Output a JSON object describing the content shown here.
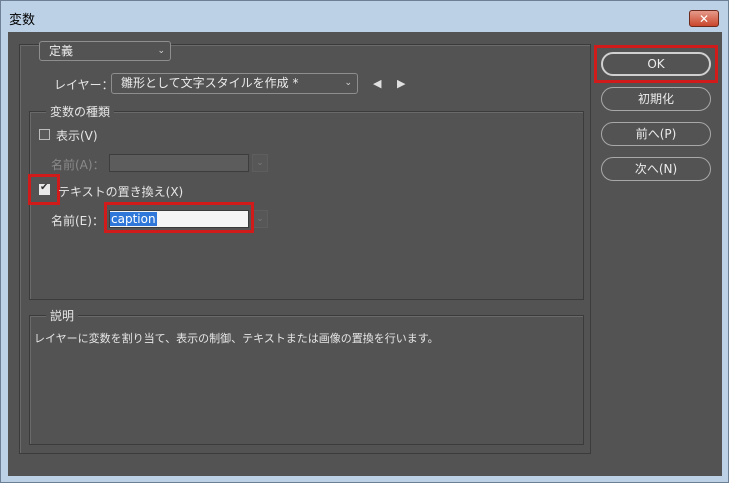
{
  "window": {
    "title": "変数",
    "close_glyph": "✕"
  },
  "definition": {
    "dropdown_value": "定義",
    "layer_label": "レイヤー：",
    "layer_value": "雛形として文字スタイルを作成 *"
  },
  "variable_types": {
    "legend": "変数の種類",
    "visibility": {
      "label": "表示(V)",
      "checked": false,
      "name_label": "名前(A)：",
      "name_value": ""
    },
    "text_replacement": {
      "label": "テキストの置き換え(X)",
      "checked": true,
      "name_label": "名前(E)：",
      "name_value": "caption"
    }
  },
  "description": {
    "legend": "説明",
    "text": "レイヤーに変数を割り当て、表示の制御、テキストまたは画像の置換を行います。"
  },
  "buttons": {
    "ok": "OK",
    "reset": "初期化",
    "prev": "前へ(P)",
    "next": "次へ(N)"
  },
  "icons": {
    "chevron": "⌄",
    "prev_arrow": "◀",
    "next_arrow": "▶"
  },
  "colors": {
    "highlight": "#d11a1a",
    "selection": "#2f77d8",
    "panel": "#535353"
  }
}
